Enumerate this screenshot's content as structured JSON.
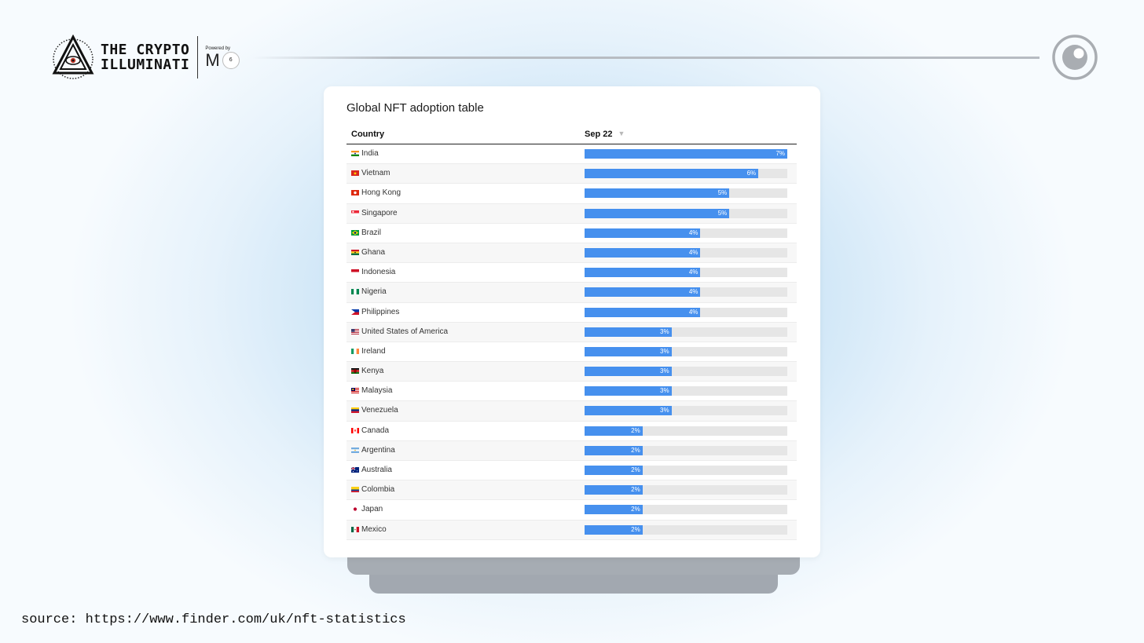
{
  "brand": {
    "name_line1": "THE CRYPTO",
    "name_line2": "ILLUMINATI",
    "powered_by_label": "Powered by",
    "powered_by_mark": "M",
    "powered_by_badge": "6"
  },
  "card": {
    "title": "Global NFT adoption table"
  },
  "table": {
    "col_country": "Country",
    "col_date": "Sep 22"
  },
  "chart_data": {
    "type": "bar",
    "orientation": "horizontal",
    "title": "Global NFT adoption table",
    "unit": "%",
    "xlim": [
      0,
      7
    ],
    "categories": [
      "India",
      "Vietnam",
      "Hong Kong",
      "Singapore",
      "Brazil",
      "Ghana",
      "Indonesia",
      "Nigeria",
      "Philippines",
      "United States of America",
      "Ireland",
      "Kenya",
      "Malaysia",
      "Venezuela",
      "Canada",
      "Argentina",
      "Australia",
      "Colombia",
      "Japan",
      "Mexico"
    ],
    "series": [
      {
        "name": "Sep 22",
        "color": "#4690ee",
        "values": [
          7,
          6,
          5,
          5,
          4,
          4,
          4,
          4,
          4,
          3,
          3,
          3,
          3,
          3,
          2,
          2,
          2,
          2,
          2,
          2
        ],
        "labels": [
          "7%",
          "6%",
          "5%",
          "5%",
          "4%",
          "4%",
          "4%",
          "4%",
          "4%",
          "3%",
          "3%",
          "3%",
          "3%",
          "3%",
          "2%",
          "2%",
          "2%",
          "2%",
          "2%",
          "2%"
        ],
        "precise_values": [
          7.0,
          6.0,
          5.0,
          5.0,
          4.0,
          4.0,
          4.0,
          4.0,
          4.0,
          3.0,
          3.0,
          3.0,
          3.0,
          3.0,
          2.0,
          2.0,
          2.0,
          2.0,
          2.0,
          2.0
        ]
      }
    ],
    "flags": [
      "india",
      "vietnam",
      "hongkong",
      "singapore",
      "brazil",
      "ghana",
      "indonesia",
      "nigeria",
      "philippines",
      "usa",
      "ireland",
      "kenya",
      "malaysia",
      "venezuela",
      "canada",
      "argentina",
      "australia",
      "colombia",
      "japan",
      "mexico"
    ],
    "flags_shown": true
  },
  "source": "source: https://www.finder.com/uk/nft-statistics",
  "colors": {
    "bar": "#4690ee",
    "track": "#e6e6e6",
    "background_center": "#a9d2ef"
  },
  "icons": {
    "logo": "illuminati-triangle-eye-icon",
    "sort": "sort-desc-icon",
    "eye": "eye-icon"
  }
}
